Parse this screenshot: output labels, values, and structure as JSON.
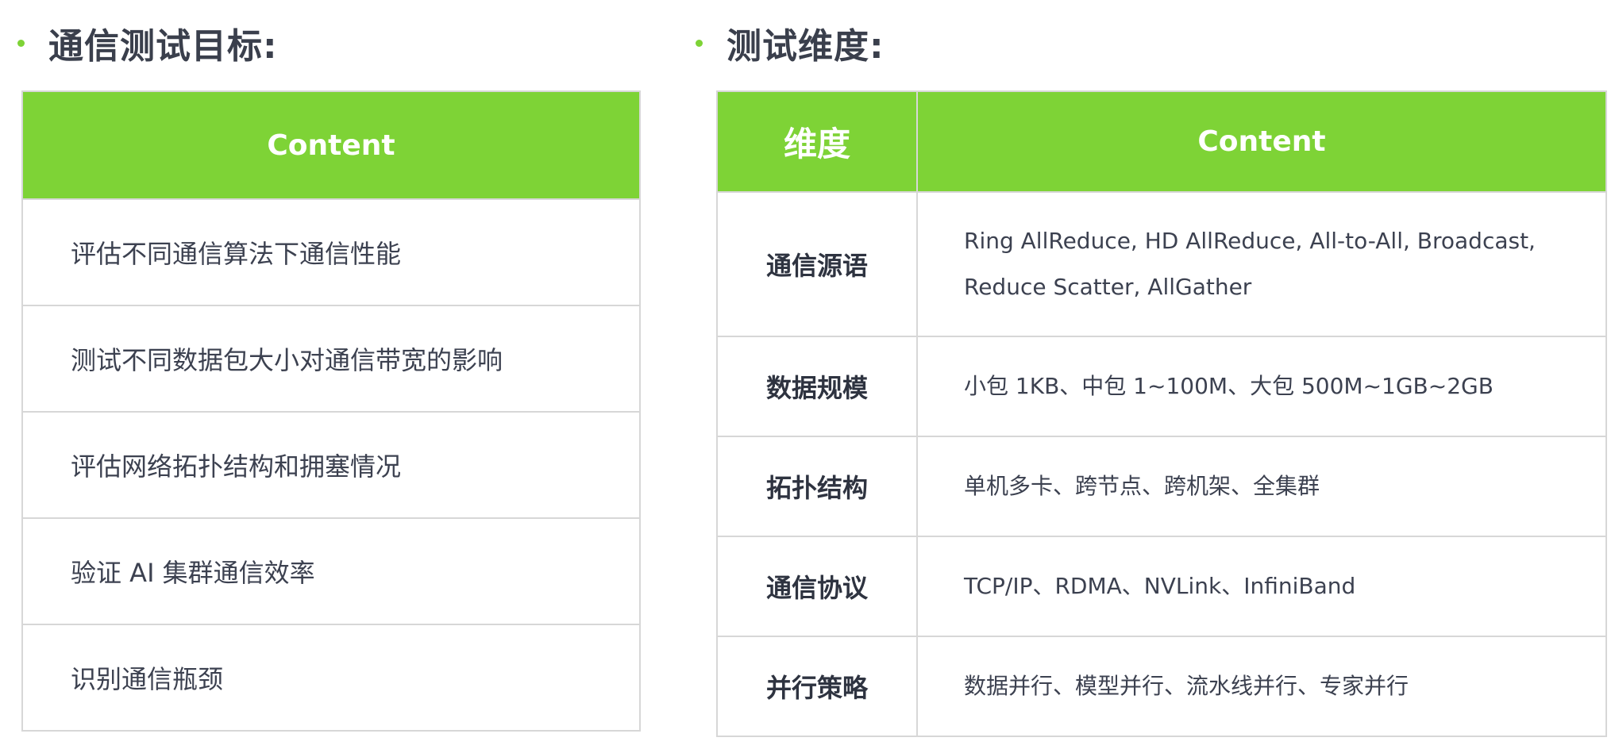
{
  "left": {
    "heading": "通信测试目标:",
    "header": "Content",
    "rows": [
      "评估不同通信算法下通信性能",
      "测试不同数据包大小对通信带宽的影响",
      "评估网络拓扑结构和拥塞情况",
      "验证 AI 集群通信效率",
      "识别通信瓶颈"
    ]
  },
  "right": {
    "heading": "测试维度:",
    "headers": [
      "维度",
      "Content"
    ],
    "rows": [
      {
        "dimension": "通信源语",
        "content": "Ring AllReduce, HD AllReduce, All-to-All, Broadcast, Reduce Scatter, AllGather"
      },
      {
        "dimension": "数据规模",
        "content": "小包 1KB、中包 1~100M、大包 500M~1GB~2GB"
      },
      {
        "dimension": "拓扑结构",
        "content": "单机多卡、跨节点、跨机架、全集群"
      },
      {
        "dimension": "通信协议",
        "content": "TCP/IP、RDMA、NVLink、InfiniBand"
      },
      {
        "dimension": "并行策略",
        "content": "数据并行、模型并行、流水线并行、专家并行"
      }
    ]
  },
  "colors": {
    "accent": "#7ed336",
    "border": "#d7d7d7",
    "text": "#3c4150"
  }
}
